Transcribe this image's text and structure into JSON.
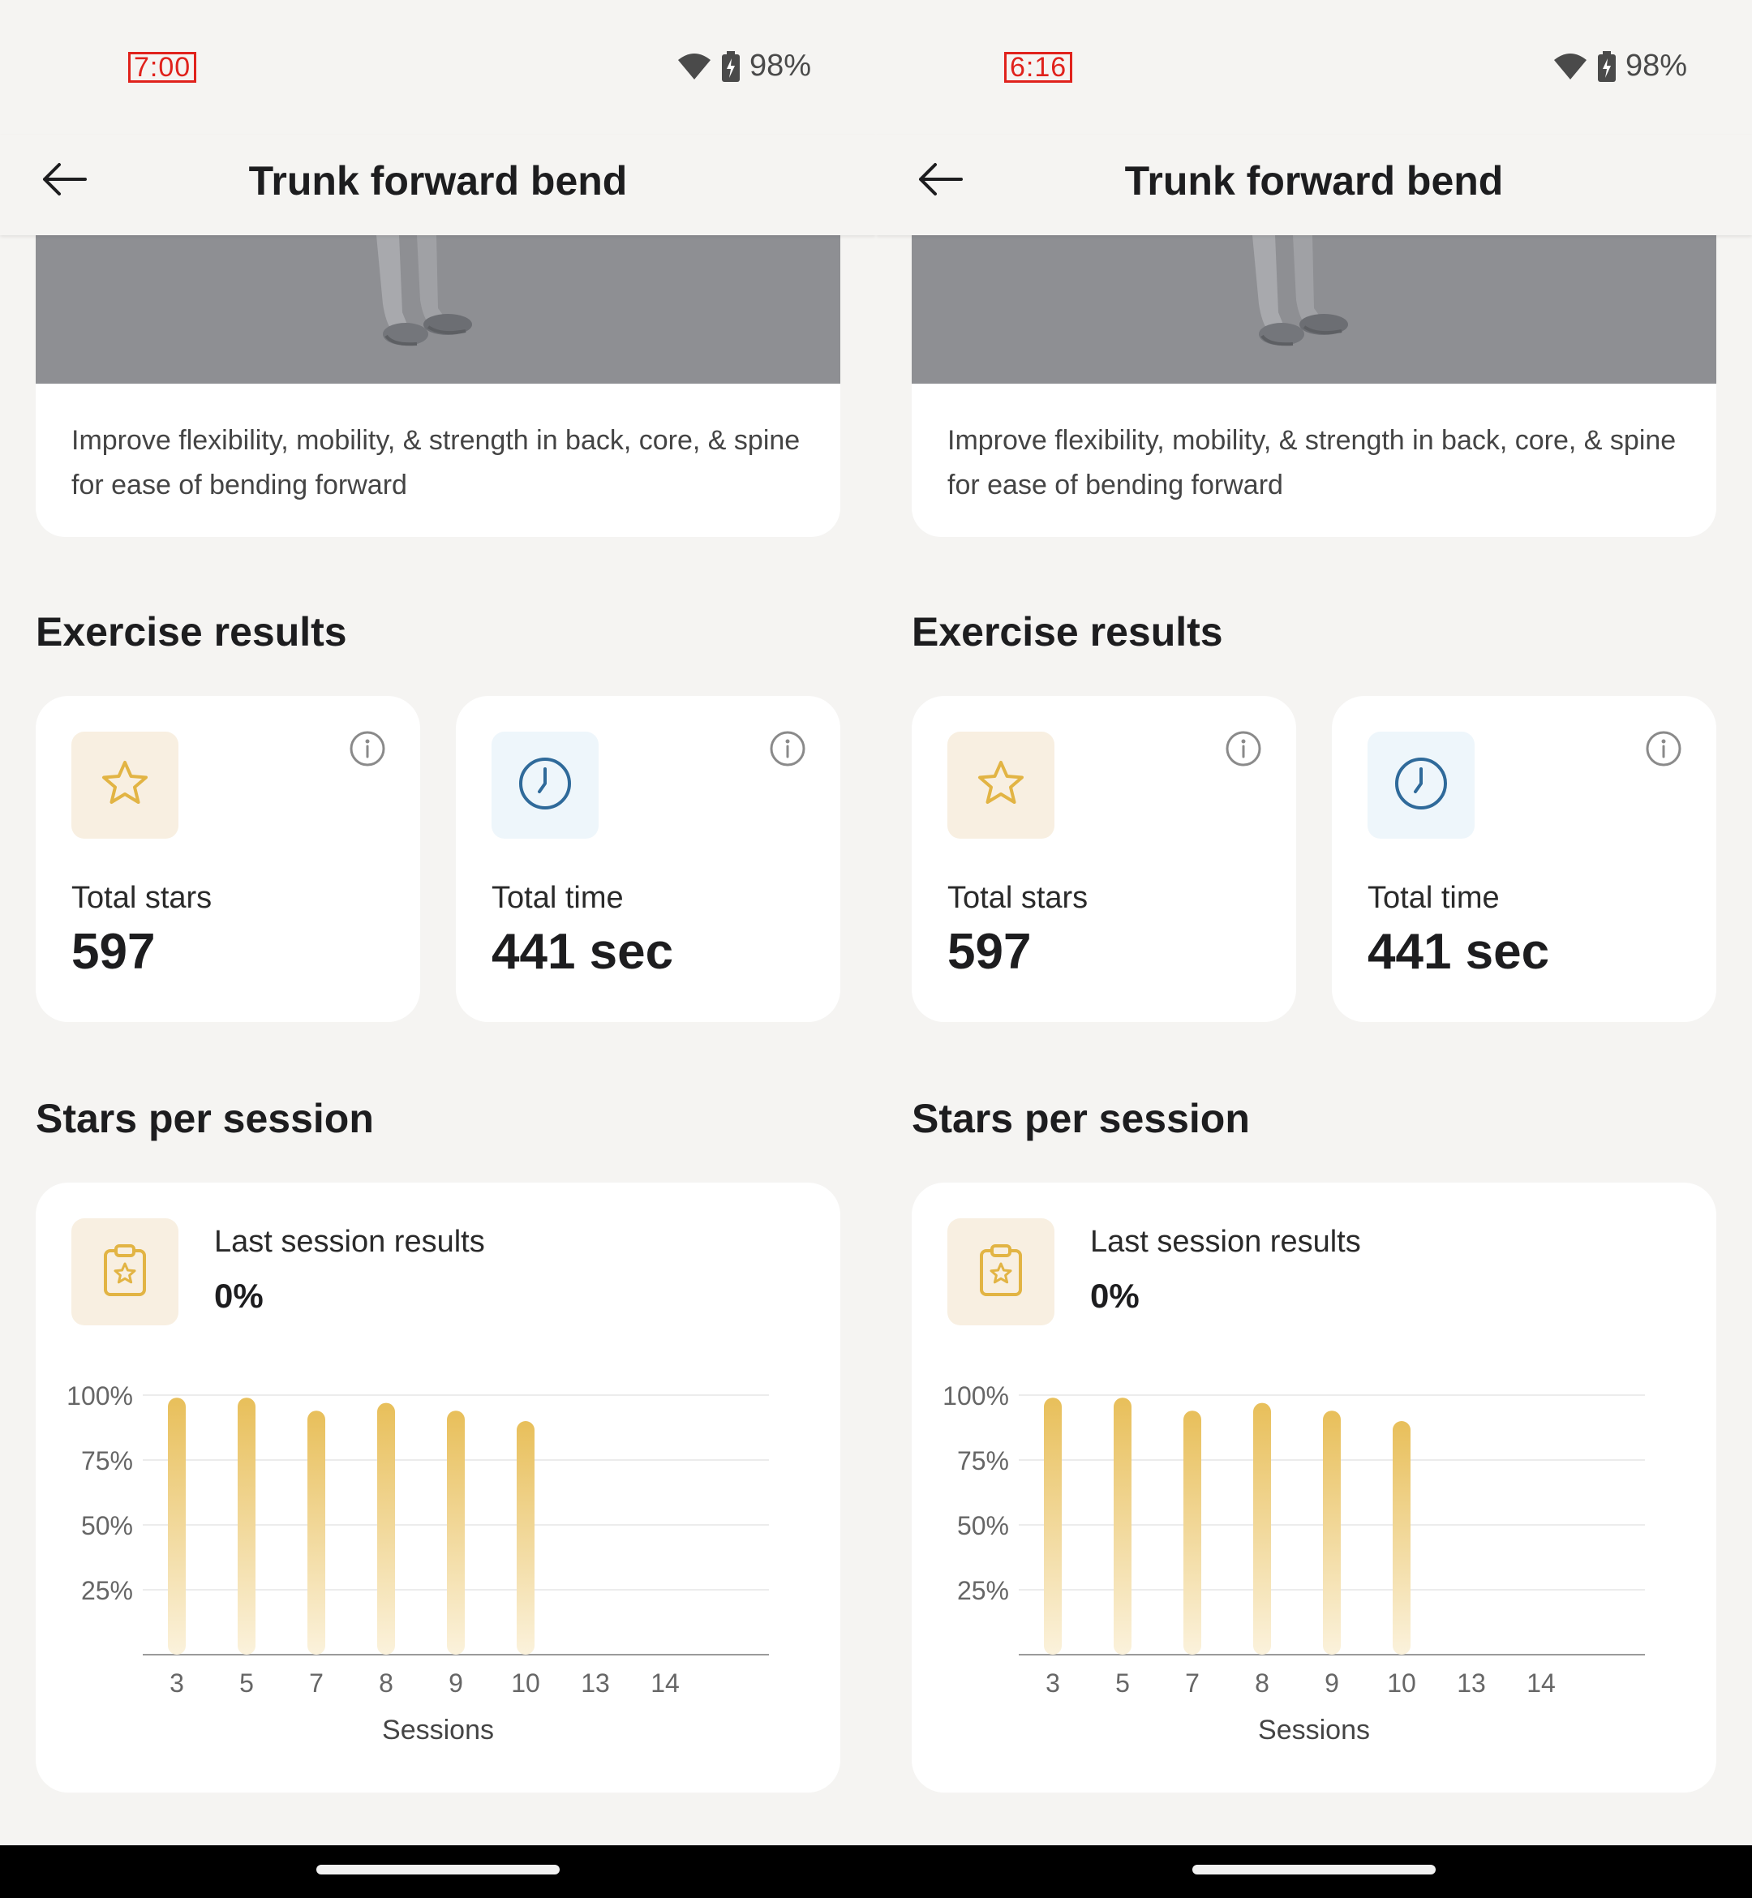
{
  "panes": [
    {
      "status": {
        "time": "7:00",
        "battery": "98%"
      },
      "header": {
        "title": "Trunk forward bend"
      },
      "intro": {
        "description": "Improve flexibility, mobility, & strength in back, core, & spine for ease of bending forward"
      },
      "results": {
        "title": "Exercise results",
        "stars": {
          "label": "Total stars",
          "value": "597"
        },
        "time": {
          "label": "Total time",
          "value": "441 sec"
        }
      },
      "session": {
        "title": "Stars per session",
        "last_label": "Last session results",
        "last_value": "0%",
        "xlabel": "Sessions"
      }
    },
    {
      "status": {
        "time": "6:16",
        "battery": "98%"
      },
      "header": {
        "title": "Trunk forward bend"
      },
      "intro": {
        "description": "Improve flexibility, mobility, & strength in back, core, & spine for ease of bending forward"
      },
      "results": {
        "title": "Exercise results",
        "stars": {
          "label": "Total stars",
          "value": "597"
        },
        "time": {
          "label": "Total time",
          "value": "441 sec"
        }
      },
      "session": {
        "title": "Stars per session",
        "last_label": "Last session results",
        "last_value": "0%",
        "xlabel": "Sessions"
      }
    }
  ],
  "icons": {
    "back": "arrow-left-icon",
    "wifi": "wifi-icon",
    "battery": "battery-charging-icon",
    "star": "star-icon",
    "clock": "clock-icon",
    "info": "info-icon",
    "clipboard": "clipboard-star-icon"
  },
  "colors": {
    "bar_top": "#e8bf5a",
    "bar_bottom": "#fbf2dc",
    "star_accent": "#e2b444",
    "clock_accent": "#2f6a9a",
    "star_bg": "#f8efe1",
    "clock_bg": "#eef6fb"
  },
  "chart_data": [
    {
      "type": "bar",
      "categories": [
        "3",
        "5",
        "7",
        "8",
        "9",
        "10",
        "13",
        "14"
      ],
      "values": [
        99,
        99,
        94,
        97,
        94,
        90,
        null,
        null
      ],
      "xlabel": "Sessions",
      "ylabel": "",
      "ytick_labels": [
        "100%",
        "75%",
        "50%",
        "25%"
      ],
      "ylim": [
        0,
        100
      ],
      "grid": true
    },
    {
      "type": "bar",
      "categories": [
        "3",
        "5",
        "7",
        "8",
        "9",
        "10",
        "13",
        "14"
      ],
      "values": [
        99,
        99,
        94,
        97,
        94,
        90,
        null,
        null
      ],
      "xlabel": "Sessions",
      "ylabel": "",
      "ytick_labels": [
        "100%",
        "75%",
        "50%",
        "25%"
      ],
      "ylim": [
        0,
        100
      ],
      "grid": true
    }
  ]
}
